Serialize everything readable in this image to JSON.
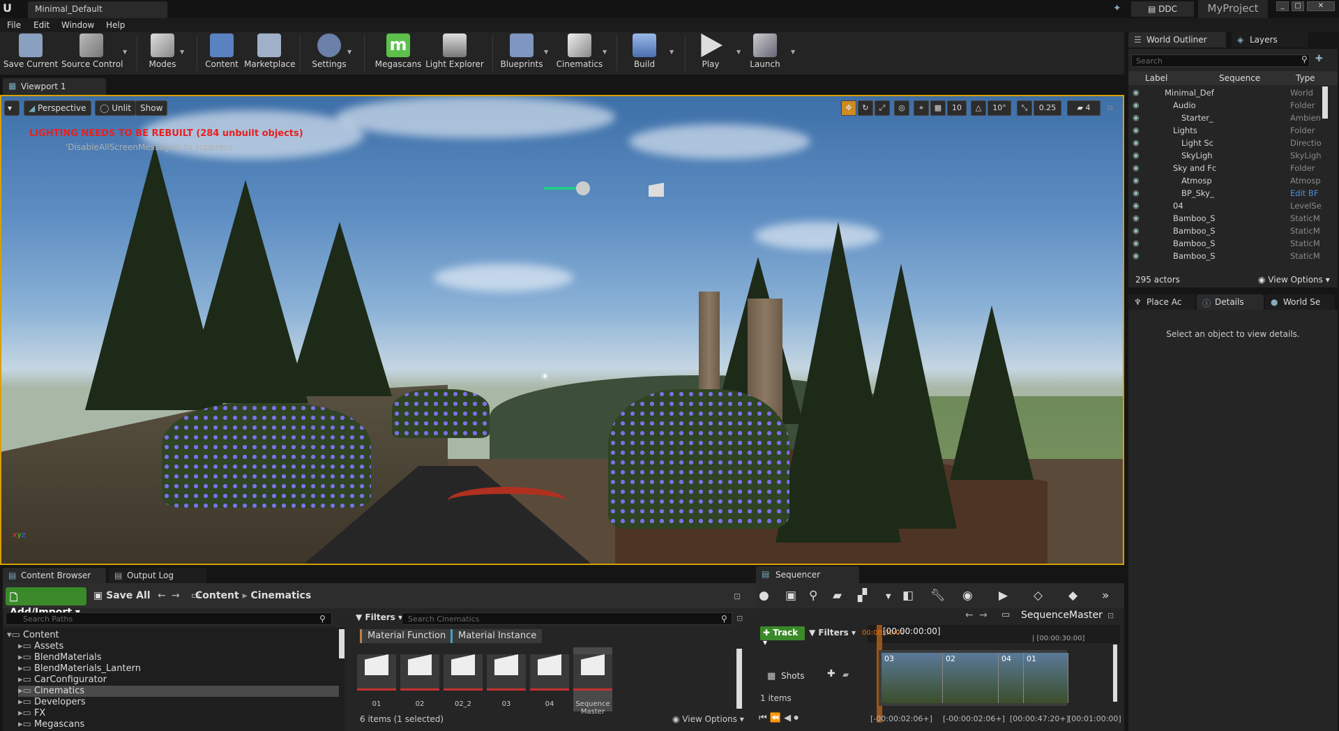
{
  "app": {
    "doc_tab": "Minimal_Default",
    "ddc_label": "DDC",
    "project": "MyProject",
    "menu": [
      "File",
      "Edit",
      "Window",
      "Help"
    ]
  },
  "toolbar": {
    "items": [
      {
        "label": "Save Current",
        "icon": "save-icon"
      },
      {
        "label": "Source Control",
        "icon": "source-control-icon"
      },
      {
        "label": "Modes",
        "icon": "modes-icon"
      },
      {
        "label": "Content",
        "icon": "content-icon"
      },
      {
        "label": "Marketplace",
        "icon": "marketplace-icon"
      },
      {
        "label": "Settings",
        "icon": "settings-icon"
      },
      {
        "label": "Megascans",
        "icon": "megascans-icon"
      },
      {
        "label": "Light Explorer",
        "icon": "light-explorer-icon"
      },
      {
        "label": "Blueprints",
        "icon": "blueprints-icon"
      },
      {
        "label": "Cinematics",
        "icon": "cinematics-icon"
      },
      {
        "label": "Build",
        "icon": "build-icon"
      },
      {
        "label": "Play",
        "icon": "play-icon"
      },
      {
        "label": "Launch",
        "icon": "launch-icon"
      }
    ],
    "megascans_letter": "m"
  },
  "viewport": {
    "tab": "Viewport 1",
    "perspective": "Perspective",
    "unlit": "Unlit",
    "show": "Show",
    "grid_snap": "10",
    "rot_snap": "10°",
    "scale_snap": "0.25",
    "cam_speed": "4",
    "warning": "LIGHTING NEEDS TO BE REBUILT (284 unbuilt objects)",
    "warning_hint": "'DisableAllScreenMessages' to suppress"
  },
  "outliner": {
    "tab_outliner": "World Outliner",
    "tab_layers": "Layers",
    "search_placeholder": "Search",
    "col_label": "Label",
    "col_sequence": "Sequence",
    "col_type": "Type",
    "rows": [
      {
        "label": "Minimal_Def",
        "type": "World"
      },
      {
        "label": "Audio",
        "type": "Folder"
      },
      {
        "label": "Starter_",
        "type": "Ambien"
      },
      {
        "label": "Lights",
        "type": "Folder"
      },
      {
        "label": "Light Sc",
        "type": "Directio"
      },
      {
        "label": "SkyLigh",
        "type": "SkyLigh"
      },
      {
        "label": "Sky and Fc",
        "type": "Folder"
      },
      {
        "label": "Atmosp",
        "type": "Atmosp"
      },
      {
        "label": "BP_Sky_",
        "type": "Edit BF"
      },
      {
        "label": "04",
        "type": "LevelSe"
      },
      {
        "label": "Bamboo_S",
        "type": "StaticM"
      },
      {
        "label": "Bamboo_S",
        "type": "StaticM"
      },
      {
        "label": "Bamboo_S",
        "type": "StaticM"
      },
      {
        "label": "Bamboo_S",
        "type": "StaticM"
      }
    ],
    "actor_count": "295 actors",
    "view_options": "View Options"
  },
  "details": {
    "tab_place": "Place Ac",
    "tab_details": "Details",
    "tab_world": "World Se",
    "empty_msg": "Select an object to view details."
  },
  "content_browser": {
    "tab": "Content Browser",
    "tab_output": "Output Log",
    "add_import": "Add/Import",
    "save_all": "Save All",
    "crumb_root": "Content",
    "crumb_current": "Cinematics",
    "path_search": "Search Paths",
    "filters": "Filters",
    "asset_search": "Search Cinematics",
    "filter_tags": [
      "Material Function",
      "Material Instance"
    ],
    "tree": [
      {
        "label": "Content",
        "depth": 0
      },
      {
        "label": "Assets",
        "depth": 1
      },
      {
        "label": "BlendMaterials",
        "depth": 1
      },
      {
        "label": "BlendMaterials_Lantern",
        "depth": 1
      },
      {
        "label": "CarConfigurator",
        "depth": 1
      },
      {
        "label": "Cinematics",
        "depth": 1
      },
      {
        "label": "Developers",
        "depth": 1
      },
      {
        "label": "FX",
        "depth": 1
      },
      {
        "label": "Megascans",
        "depth": 1
      }
    ],
    "assets": [
      "01",
      "02",
      "02_2",
      "03",
      "04",
      "Sequence Master"
    ],
    "count": "6 items (1 selected)",
    "view_options": "View Options"
  },
  "sequencer": {
    "tab": "Sequencer",
    "master": "SequenceMaster",
    "track": "Track",
    "filters": "Filters",
    "current_time": "[00:00:00:00]",
    "time_overlay": "00:00:00:00",
    "mark_30": "| [00:00:30:00]",
    "shots_label": "Shots",
    "shots": [
      "03",
      "02",
      "04",
      "01"
    ],
    "items": "1 items",
    "tc1": "[-00:00:02:06+]",
    "tc2": "[-00:00:02:06+]",
    "tc3": "[00:00:47:20+]",
    "tc4": "[00:01:00:00]"
  }
}
